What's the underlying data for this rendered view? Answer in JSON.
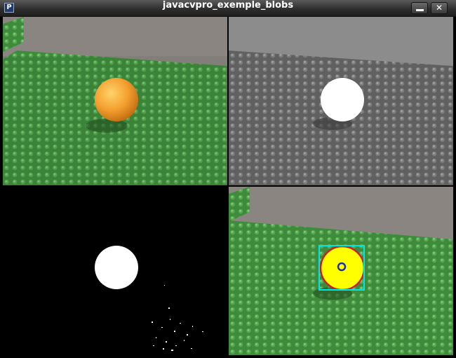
{
  "window": {
    "title": "javacvpro_exemple_blobs",
    "app_icon": "processing-app-icon",
    "app_icon_glyph": "P",
    "close_glyph": "✕"
  },
  "colors": {
    "mat_green": "#3f8b3c",
    "ball_orange": "#f2a033",
    "floor_grey": "#8a8580",
    "blob_fill": "#ffff00",
    "blob_contour": "#cc2020",
    "bounding_box": "#00e5e5",
    "centroid": "#1a2fb0"
  },
  "panels": [
    {
      "id": "source-color",
      "desc_icon": "camera-frame"
    },
    {
      "id": "grayscale",
      "desc_icon": "camera-frame"
    },
    {
      "id": "binary-threshold",
      "desc_icon": "camera-frame"
    },
    {
      "id": "blob-detection",
      "desc_icon": "camera-frame"
    }
  ]
}
